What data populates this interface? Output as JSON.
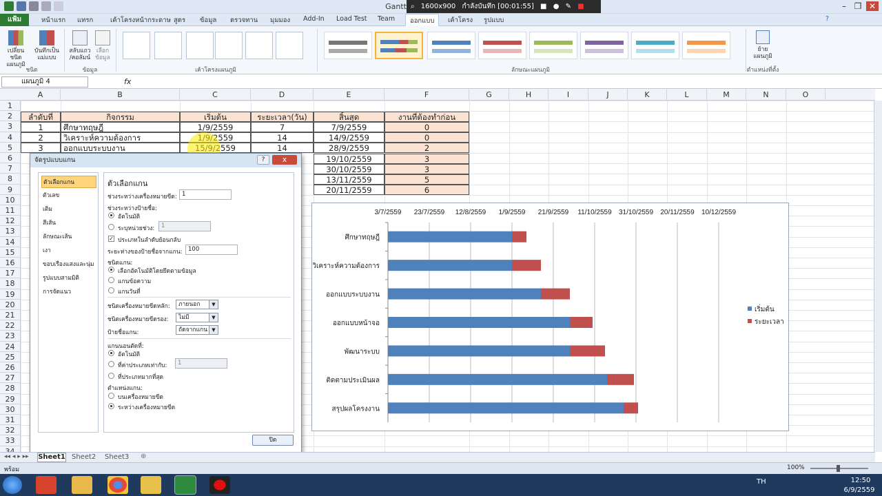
{
  "window": {
    "title": "GanttChart2 - Microsoft Excel"
  },
  "recording": {
    "res": "1600x900",
    "status": "กำลังบันทึก [00:01:55]"
  },
  "tabs": [
    "แฟ้ม",
    "หน้าแรก",
    "แทรก",
    "เค้าโครงหน้ากระดาษ",
    "สูตร",
    "ข้อมูล",
    "ตรวจทาน",
    "มุมมอง",
    "Add-In",
    "Load Test",
    "Team",
    "ออกแบบ",
    "เค้าโครง",
    "รูปแบบ"
  ],
  "ribbon": {
    "change_type": "เปลี่ยนชนิด แผนภูมิ",
    "save_template": "บันทึกเป็น แม่แบบ",
    "switch_rowcol": "สลับแถว /คอลัมน์",
    "select_data": "เลือก ข้อมูล",
    "group_type": "ชนิด",
    "group_data": "ข้อมูล",
    "group_layouts": "เค้าโครงแผนภูมิ",
    "group_styles": "ลักษณะแผนภูมิ",
    "move_chart": "ย้าย แผนภูมิ",
    "group_location": "ตำแหน่งที่ตั้ง"
  },
  "formula": {
    "namebox": "แผนภูมิ 4",
    "fx": "fx"
  },
  "columns": [
    "A",
    "B",
    "C",
    "D",
    "E",
    "F",
    "G",
    "H",
    "I",
    "J",
    "K",
    "L",
    "M",
    "N",
    "O"
  ],
  "rows": [
    "1",
    "2",
    "3",
    "4",
    "5",
    "6",
    "7",
    "8",
    "9",
    "10",
    "11",
    "12",
    "13",
    "14",
    "15",
    "16",
    "17",
    "18",
    "19",
    "20",
    "21",
    "22",
    "23",
    "24",
    "25",
    "26",
    "27",
    "28",
    "29",
    "30",
    "31",
    "32",
    "33",
    "34"
  ],
  "sheet": {
    "headers": [
      "ลำดับที่",
      "กิจกรรม",
      "เริ่มต้น",
      "ระยะเวลา(วัน)",
      "สิ้นสุด",
      "งานที่ต้องทำก่อน"
    ],
    "data": [
      [
        "1",
        "ศึกษาทฤษฎี",
        "1/9/2559",
        "7",
        "7/9/2559",
        "0"
      ],
      [
        "2",
        "วิเคราะห์ความต้องการ",
        "1/9/2559",
        "14",
        "14/9/2559",
        "0"
      ],
      [
        "3",
        "ออกแบบระบบงาน",
        "15/9/2559",
        "14",
        "28/9/2559",
        "2"
      ]
    ],
    "partial_e": [
      "19/10/2559",
      "30/10/2559",
      "13/11/2559",
      "20/11/2559"
    ],
    "partial_f": [
      "3",
      "3",
      "5",
      "6"
    ]
  },
  "dialog": {
    "title": "จัดรูปแบบแกน",
    "nav": [
      "ตัวเลือกแกน",
      "ตัวเลข",
      "เติม",
      "สีเส้น",
      "ลักษณะเส้น",
      "เงา",
      "ขอบเรืองแสงและนุ่ม",
      "รูปแบบสามมิติ",
      "การจัดแนว"
    ],
    "heading": "ตัวเลือกแกน",
    "tick_interval_label": "ช่วงระหว่างเครื่องหมายขีด:",
    "tick_interval_value": "1",
    "label_interval_label": "ช่วงระหว่างป้ายชื่อ:",
    "auto": "อัตโนมัติ",
    "specify_unit": "ระบุหน่วยช่วง:",
    "specify_unit_value": "1",
    "reverse_order": "ประเภทในลำดับย้อนกลับ",
    "label_distance_label": "ระยะห่างของป้ายชื่อจากแกน:",
    "label_distance_value": "100",
    "axis_type_label": "ชนิดแกน:",
    "axis_auto": "เลือกอัตโนมัติโดยยึดตามข้อมูล",
    "axis_text": "แกนข้อความ",
    "axis_date": "แกนวันที่",
    "major_tick_label": "ชนิดเครื่องหมายขีดหลัก:",
    "major_tick_value": "ภายนอก",
    "minor_tick_label": "ชนิดเครื่องหมายขีดรอง:",
    "minor_tick_value": "ไม่มี",
    "axis_labels_label": "ป้ายชื่อแกน:",
    "axis_labels_value": "ถัดจากแกน",
    "cross_label": "แกนนอนตัดที่:",
    "cross_auto": "อัตโนมัติ",
    "cross_at": "ที่ค่าประเภทเท่ากับ:",
    "cross_at_value": "1",
    "cross_max": "ที่ประเภทมากที่สุด",
    "position_label": "ตำแหน่งแกน:",
    "pos_on": "บนเครื่องหมายขีด",
    "pos_between": "ระหว่างเครื่องหมายขีด",
    "close": "ปิด",
    "help": "?",
    "close_x": "x"
  },
  "chart_data": {
    "type": "bar",
    "categories": [
      "ศึกษาทฤษฎี",
      "วิเคราะห์ความต้องการ",
      "ออกแบบระบบงาน",
      "ออกแบบหน้าจอ",
      "พัฒนาระบบ",
      "ติดตามประเมินผล",
      "สรุปผลโครงงาน"
    ],
    "x_ticks": [
      "3/7/2559",
      "23/7/2559",
      "12/8/2559",
      "1/9/2559",
      "21/9/2559",
      "11/10/2559",
      "31/10/2559",
      "20/11/2559",
      "10/12/2559"
    ],
    "xlim_days_from_3_7_2559": [
      0,
      160
    ],
    "series": [
      {
        "name": "เริ่มต้น",
        "color": "#4f81bd",
        "values": [
          "1/9/2559",
          "1/9/2559",
          "15/9/2559",
          "29/9/2559",
          "29/9/2559",
          "17/10/2559",
          "25/10/2559"
        ]
      },
      {
        "name": "ระยะเวลา",
        "color": "#c0504d",
        "values": [
          7,
          14,
          14,
          11,
          17,
          13,
          7
        ]
      }
    ],
    "legend": "right",
    "stacked": true
  },
  "sheettabs": [
    "Sheet1",
    "Sheet2",
    "Sheet3"
  ],
  "status": {
    "ready": "พร้อม",
    "zoom": "100%"
  },
  "taskbar": {
    "lang": "TH",
    "time": "12:50",
    "date": "6/9/2559"
  }
}
